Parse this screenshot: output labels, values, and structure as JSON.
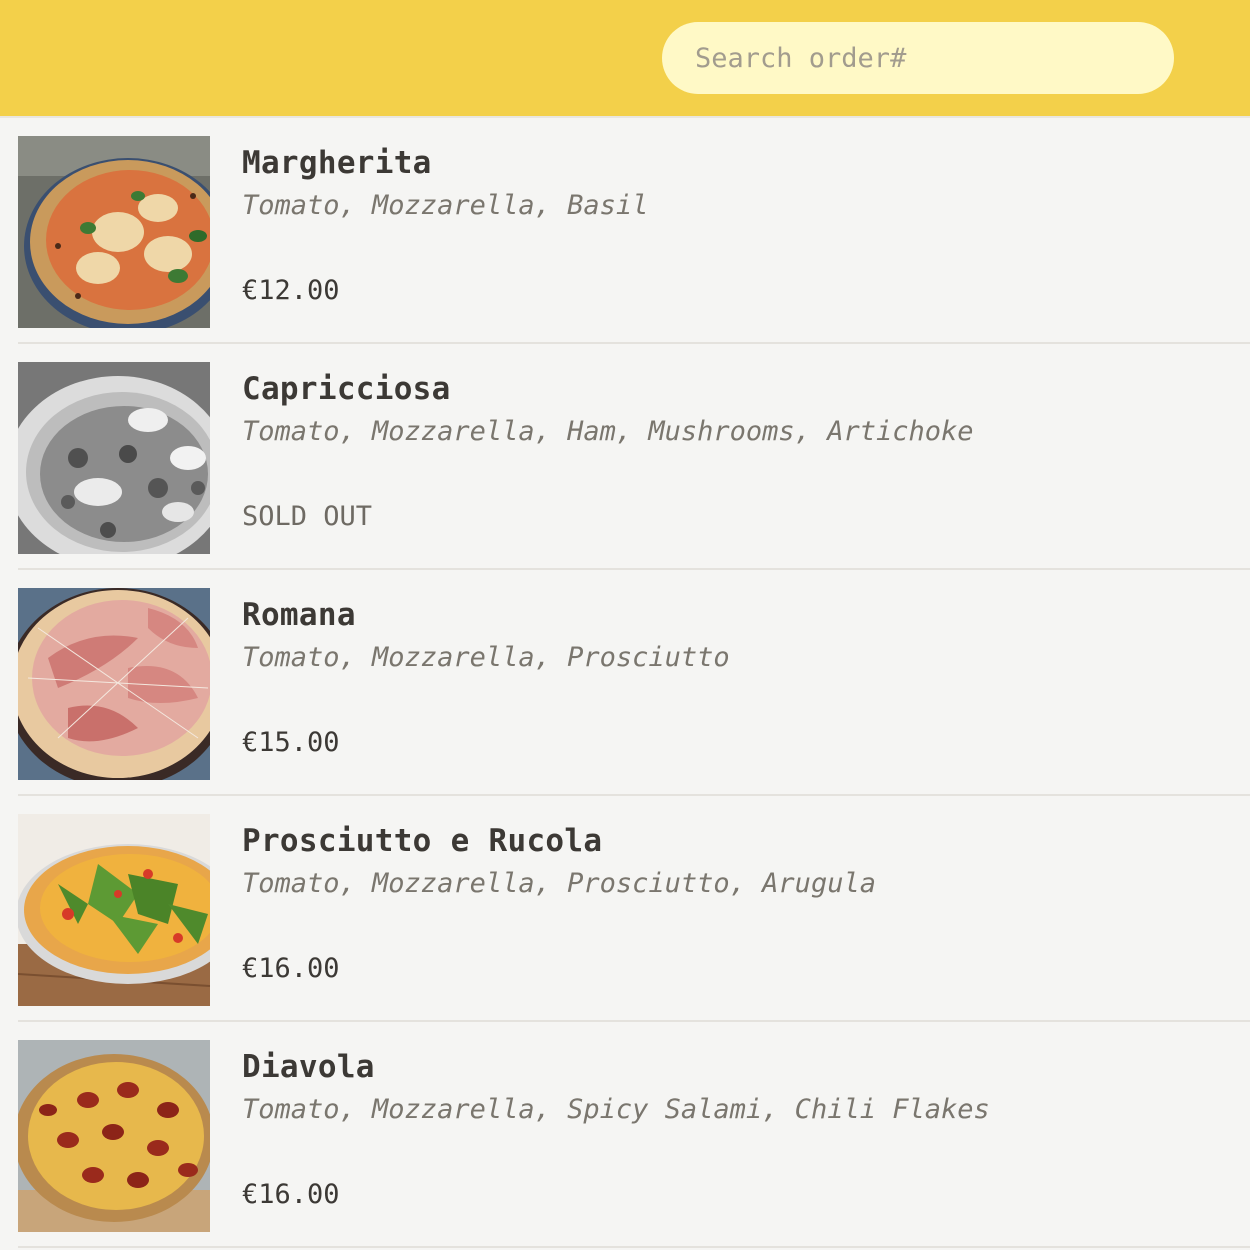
{
  "header": {
    "search_placeholder": "Search order#",
    "search_value": ""
  },
  "menu": {
    "items": [
      {
        "name": "Margherita",
        "ingredients": "Tomato, Mozzarella, Basil",
        "price": "€12.00",
        "sold_out": false
      },
      {
        "name": "Capricciosa",
        "ingredients": "Tomato, Mozzarella, Ham, Mushrooms, Artichoke",
        "price": "SOLD OUT",
        "sold_out": true
      },
      {
        "name": "Romana",
        "ingredients": "Tomato, Mozzarella, Prosciutto",
        "price": "€15.00",
        "sold_out": false
      },
      {
        "name": "Prosciutto e Rucola",
        "ingredients": "Tomato, Mozzarella, Prosciutto, Arugula",
        "price": "€16.00",
        "sold_out": false
      },
      {
        "name": "Diavola",
        "ingredients": "Tomato, Mozzarella, Spicy Salami, Chili Flakes",
        "price": "€16.00",
        "sold_out": false
      }
    ]
  },
  "colors": {
    "header_background": "#f3d04a",
    "search_background": "#fff9c6",
    "page_background": "#f5f5f3"
  }
}
